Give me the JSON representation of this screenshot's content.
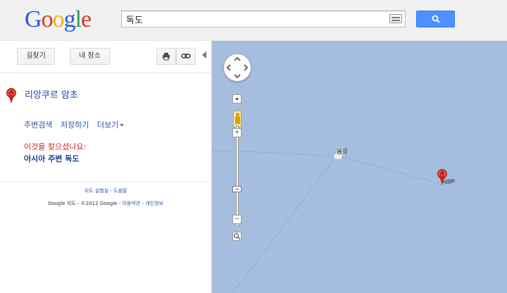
{
  "header": {
    "logo_letters": [
      {
        "ch": "G",
        "color": "#2d5bd6"
      },
      {
        "ch": "o",
        "color": "#d8362c"
      },
      {
        "ch": "o",
        "color": "#f1b310"
      },
      {
        "ch": "g",
        "color": "#2d5bd6"
      },
      {
        "ch": "l",
        "color": "#2ea347"
      },
      {
        "ch": "e",
        "color": "#d8362c"
      }
    ],
    "search_value": "독도",
    "keyboard_icon": "keyboard-icon",
    "search_icon": "magnifier-icon"
  },
  "panel": {
    "directions_label": "길찾기",
    "myplaces_label": "내 장소",
    "print_icon": "printer-icon",
    "link_icon": "link-icon",
    "result": {
      "marker_letter": "A",
      "title": "리앙쿠르 암초"
    },
    "actions": {
      "nearby": "주변검색",
      "save": "저장하기",
      "more": "더보기"
    },
    "did_you_mean": "이것을 찾으셨나요:",
    "suggestion": "아시아 주변 독도",
    "footer_help": "지도 실험실 - 도움말",
    "footer_copy_prefix": "Google 지도 - ©2012 Google - ",
    "footer_terms": "이용약관",
    "footer_sep": " - ",
    "footer_privacy": "개인정보"
  },
  "map": {
    "water_color": "#a5bedf",
    "island_label": "울릉",
    "marker_letter": "A",
    "zoom_in_label": "+",
    "zoom_out_label": "−"
  }
}
